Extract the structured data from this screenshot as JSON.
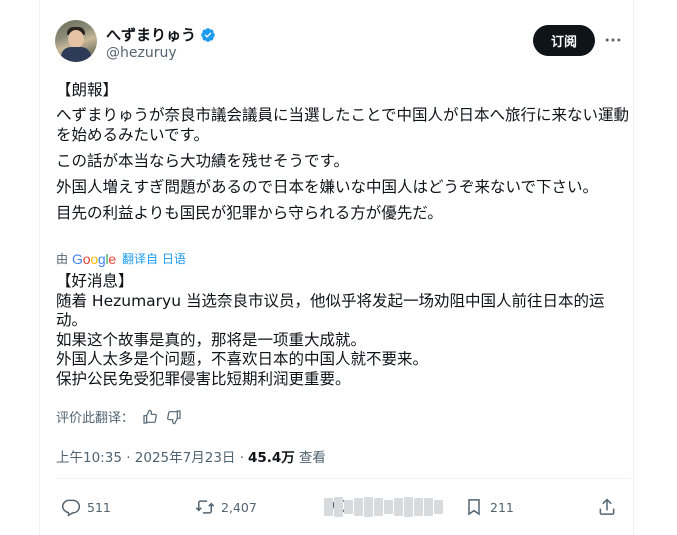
{
  "author": {
    "display_name": "へずまりゅう",
    "handle": "@hezuruy"
  },
  "actions": {
    "subscribe_label": "订阅",
    "more_icon": "more-dots-icon"
  },
  "post": {
    "lines": [
      "【朗報】",
      "へずまりゅうが奈良市議会議員に当選したことで中国人が日本へ旅行に来ない運動を始めるみたいです。",
      "この話が本当なら大功績を残せそうです。",
      "外国人増えすぎ問題があるので日本を嫌いな中国人はどうぞ来ないで下さい。",
      "目先の利益よりも国民が犯罪から守られる方が優先だ。"
    ]
  },
  "translation": {
    "by": "由",
    "provider": "Google",
    "link_label": "翻译自 日语",
    "lines": [
      "【好消息】",
      "随着 Hezumaryu 当选奈良市议员，他似乎将发起一场劝阻中国人前往日本的运动。",
      "如果这个故事是真的，那将是一项重大成就。",
      "外国人太多是个问题，不喜欢日本的中国人就不要来。",
      "保护公民免受犯罪侵害比短期利润更重要。"
    ],
    "rate_label": "评价此翻译："
  },
  "meta": {
    "time": "上午10:35 · 2025年7月23日 · ",
    "views": "45.4万",
    "views_label": "查看"
  },
  "stats": {
    "replies": "511",
    "retweets": "2,407",
    "likes": "",
    "bookmarks": "211"
  },
  "colors": {
    "accent": "#1d9bf0",
    "text": "#0f1419",
    "muted": "#536471"
  }
}
